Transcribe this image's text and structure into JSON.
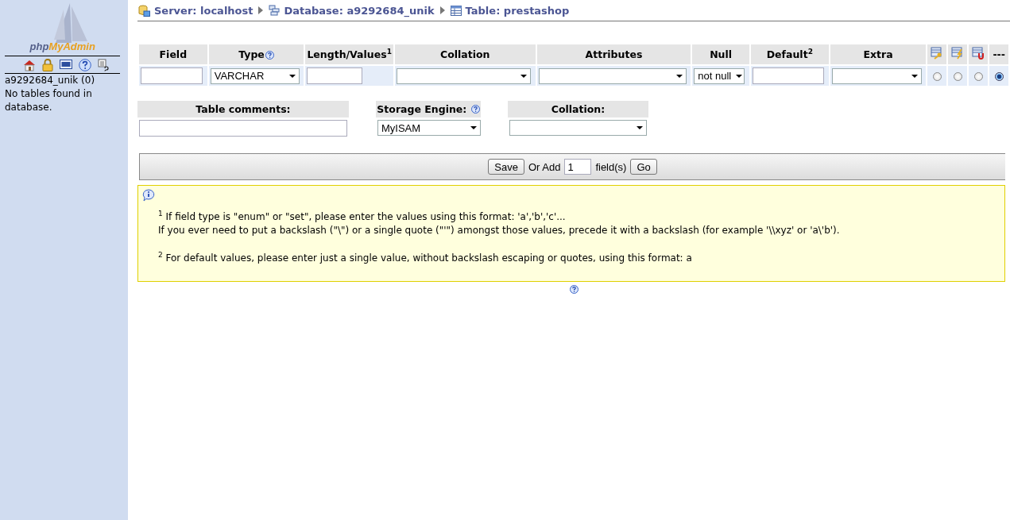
{
  "sidebar": {
    "logo": {
      "first": "php",
      "second": "MyAdmin"
    },
    "icons": [
      {
        "kind": "home"
      },
      {
        "kind": "lock"
      },
      {
        "kind": "sql"
      },
      {
        "kind": "help"
      },
      {
        "kind": "docs"
      }
    ],
    "database": "a9292684_unik (0)",
    "message": "No tables found in database."
  },
  "breadcrumb": [
    {
      "kind": "server",
      "label": "Server: localhost"
    },
    {
      "kind": "database",
      "label": "Database: a9292684_unik"
    },
    {
      "kind": "table",
      "label": "Table: prestashop"
    }
  ],
  "fields_table": {
    "columns": [
      {
        "label": "Field"
      },
      {
        "label": "Type",
        "help": true
      },
      {
        "label": "Length/Values$^{1}$"
      },
      {
        "label": "Collation"
      },
      {
        "label": "Attributes"
      },
      {
        "label": "Null"
      },
      {
        "label": "Default$^{2}$"
      },
      {
        "label": "Extra"
      }
    ],
    "radio_columns": [
      {
        "kind": "primary"
      },
      {
        "kind": "index"
      },
      {
        "kind": "unique"
      },
      {
        "kind": "text",
        "label": "---"
      }
    ],
    "row": {
      "cells": [
        {
          "kind": "input"
        },
        {
          "kind": "select",
          "value": "VARCHAR"
        },
        {
          "kind": "input"
        },
        {
          "kind": "select"
        },
        {
          "kind": "select"
        },
        {
          "kind": "select",
          "value": "not null"
        },
        {
          "kind": "input"
        },
        {
          "kind": "select"
        }
      ],
      "radios": [
        {
          "selected": false
        },
        {
          "selected": false
        },
        {
          "selected": false
        },
        {
          "selected": true
        }
      ]
    }
  },
  "table_options": [
    {
      "label": "Table comments:",
      "kind": "input"
    },
    {
      "label": "Storage Engine:",
      "help": true,
      "kind": "select",
      "value": "MyISAM"
    },
    {
      "label": "Collation:",
      "kind": "select"
    }
  ],
  "add_bar": {
    "save": "Save",
    "or_add": "Or Add",
    "count": "1",
    "unit": "field(s)",
    "go": "Go"
  },
  "notes": [
    {
      "lines": [
        "$^{1}$ If field type is \"enum\" or \"set\", please enter the values using this format: 'a','b','c'...",
        "If you ever need to put a backslash (\"\\\") or a single quote (\"'\") amongst those values, precede it with a backslash (for example '\\\\xyz' or 'a\\'b')."
      ]
    },
    {
      "lines": [
        "$^{2}$ For default values, please enter just a single value, without backslash escaping or quotes, using this format: a"
      ]
    }
  ]
}
